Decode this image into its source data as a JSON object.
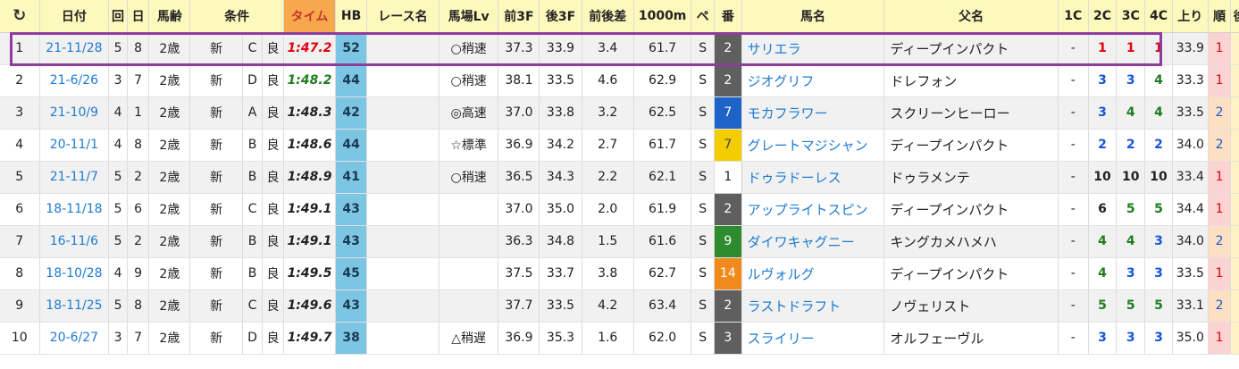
{
  "headers": {
    "reload": "C",
    "date": "日付",
    "kai": "回",
    "day": "日",
    "age": "馬齢",
    "cond": "条件",
    "time": "タイム",
    "hb": "HB",
    "race": "レース名",
    "track": "馬場Lv",
    "f3f": "前3F",
    "l3f": "後3F",
    "diff": "前後差",
    "dist": "1000m",
    "pace": "ペ",
    "num": "番",
    "horse": "馬名",
    "sire": "父名",
    "c1": "1C",
    "c2": "2C",
    "c3": "3C",
    "c4": "4C",
    "agari": "上り",
    "rank": "順",
    "extra": "後"
  },
  "rows": [
    {
      "no": "1",
      "date": "21-11/28",
      "kai": "5",
      "day": "8",
      "age": "2歳",
      "cond": "新",
      "cls": "C",
      "going": "良",
      "time": "1:47.2",
      "hb": "52",
      "race": "",
      "track": "○稍速",
      "f3f": "37.3",
      "l3f": "33.9",
      "diff": "3.4",
      "dist": "61.7",
      "pace": "S",
      "num": "2",
      "horse": "サリエラ",
      "sire": "ディープインパクト",
      "c1": "-",
      "c2": "1",
      "c3": "1",
      "c4": "1",
      "agari": "33.9",
      "rank": "1"
    },
    {
      "no": "2",
      "date": "21-6/26",
      "kai": "3",
      "day": "7",
      "age": "2歳",
      "cond": "新",
      "cls": "D",
      "going": "良",
      "time": "1:48.2",
      "hb": "44",
      "race": "",
      "track": "○稍速",
      "f3f": "38.1",
      "l3f": "33.5",
      "diff": "4.6",
      "dist": "62.9",
      "pace": "S",
      "num": "2",
      "horse": "ジオグリフ",
      "sire": "ドレフォン",
      "c1": "-",
      "c2": "3",
      "c3": "3",
      "c4": "4",
      "agari": "33.3",
      "rank": "1"
    },
    {
      "no": "3",
      "date": "21-10/9",
      "kai": "4",
      "day": "1",
      "age": "2歳",
      "cond": "新",
      "cls": "A",
      "going": "良",
      "time": "1:48.3",
      "hb": "42",
      "race": "",
      "track": "◎高速",
      "f3f": "37.0",
      "l3f": "33.8",
      "diff": "3.2",
      "dist": "62.5",
      "pace": "S",
      "num": "7",
      "horse": "モカフラワー",
      "sire": "スクリーンヒーロー",
      "c1": "-",
      "c2": "3",
      "c3": "4",
      "c4": "4",
      "agari": "33.5",
      "rank": "2"
    },
    {
      "no": "4",
      "date": "20-11/1",
      "kai": "4",
      "day": "8",
      "age": "2歳",
      "cond": "新",
      "cls": "B",
      "going": "良",
      "time": "1:48.6",
      "hb": "44",
      "race": "",
      "track": "☆標準",
      "f3f": "36.9",
      "l3f": "34.2",
      "diff": "2.7",
      "dist": "61.7",
      "pace": "S",
      "num": "7",
      "horse": "グレートマジシャン",
      "sire": "ディープインパクト",
      "c1": "-",
      "c2": "2",
      "c3": "2",
      "c4": "2",
      "agari": "34.0",
      "rank": "2"
    },
    {
      "no": "5",
      "date": "21-11/7",
      "kai": "5",
      "day": "2",
      "age": "2歳",
      "cond": "新",
      "cls": "B",
      "going": "良",
      "time": "1:48.9",
      "hb": "41",
      "race": "",
      "track": "○稍速",
      "f3f": "36.5",
      "l3f": "34.3",
      "diff": "2.2",
      "dist": "62.1",
      "pace": "S",
      "num": "1",
      "horse": "ドゥラドーレス",
      "sire": "ドゥラメンテ",
      "c1": "-",
      "c2": "10",
      "c3": "10",
      "c4": "10",
      "agari": "33.4",
      "rank": "1"
    },
    {
      "no": "6",
      "date": "18-11/18",
      "kai": "5",
      "day": "6",
      "age": "2歳",
      "cond": "新",
      "cls": "C",
      "going": "良",
      "time": "1:49.1",
      "hb": "43",
      "race": "",
      "track": "",
      "f3f": "37.0",
      "l3f": "35.0",
      "diff": "2.0",
      "dist": "61.9",
      "pace": "S",
      "num": "2",
      "horse": "アップライトスピン",
      "sire": "ディープインパクト",
      "c1": "-",
      "c2": "6",
      "c3": "5",
      "c4": "5",
      "agari": "34.4",
      "rank": "1"
    },
    {
      "no": "7",
      "date": "16-11/6",
      "kai": "5",
      "day": "2",
      "age": "2歳",
      "cond": "新",
      "cls": "B",
      "going": "良",
      "time": "1:49.1",
      "hb": "43",
      "race": "",
      "track": "",
      "f3f": "36.3",
      "l3f": "34.8",
      "diff": "1.5",
      "dist": "61.6",
      "pace": "S",
      "num": "9",
      "horse": "ダイワキャグニー",
      "sire": "キングカメハメハ",
      "c1": "-",
      "c2": "4",
      "c3": "4",
      "c4": "3",
      "agari": "34.0",
      "rank": "2"
    },
    {
      "no": "8",
      "date": "18-10/28",
      "kai": "4",
      "day": "9",
      "age": "2歳",
      "cond": "新",
      "cls": "B",
      "going": "良",
      "time": "1:49.5",
      "hb": "45",
      "race": "",
      "track": "",
      "f3f": "37.5",
      "l3f": "33.7",
      "diff": "3.8",
      "dist": "62.7",
      "pace": "S",
      "num": "14",
      "horse": "ルヴォルグ",
      "sire": "ディープインパクト",
      "c1": "-",
      "c2": "4",
      "c3": "3",
      "c4": "3",
      "agari": "33.5",
      "rank": "1"
    },
    {
      "no": "9",
      "date": "18-11/25",
      "kai": "5",
      "day": "8",
      "age": "2歳",
      "cond": "新",
      "cls": "C",
      "going": "良",
      "time": "1:49.6",
      "hb": "43",
      "race": "",
      "track": "",
      "f3f": "37.7",
      "l3f": "33.5",
      "diff": "4.2",
      "dist": "63.4",
      "pace": "S",
      "num": "2",
      "horse": "ラストドラフト",
      "sire": "ノヴェリスト",
      "c1": "-",
      "c2": "5",
      "c3": "5",
      "c4": "5",
      "agari": "33.1",
      "rank": "2"
    },
    {
      "no": "10",
      "date": "20-6/27",
      "kai": "3",
      "day": "7",
      "age": "2歳",
      "cond": "新",
      "cls": "D",
      "going": "良",
      "time": "1:49.7",
      "hb": "38",
      "race": "",
      "track": "△稍遅",
      "f3f": "36.9",
      "l3f": "35.3",
      "diff": "1.6",
      "dist": "62.0",
      "pace": "S",
      "num": "3",
      "horse": "スライリー",
      "sire": "オルフェーヴル",
      "c1": "-",
      "c2": "3",
      "c3": "3",
      "c4": "3",
      "agari": "35.0",
      "rank": "1"
    }
  ],
  "colors": {
    "header_bg": "#fdf8bc",
    "time_header_bg": "#f7a84d",
    "hb_bg": "#7cc6e4",
    "highlight_border": "#8e3d9c",
    "link": "#1f7bd0"
  }
}
